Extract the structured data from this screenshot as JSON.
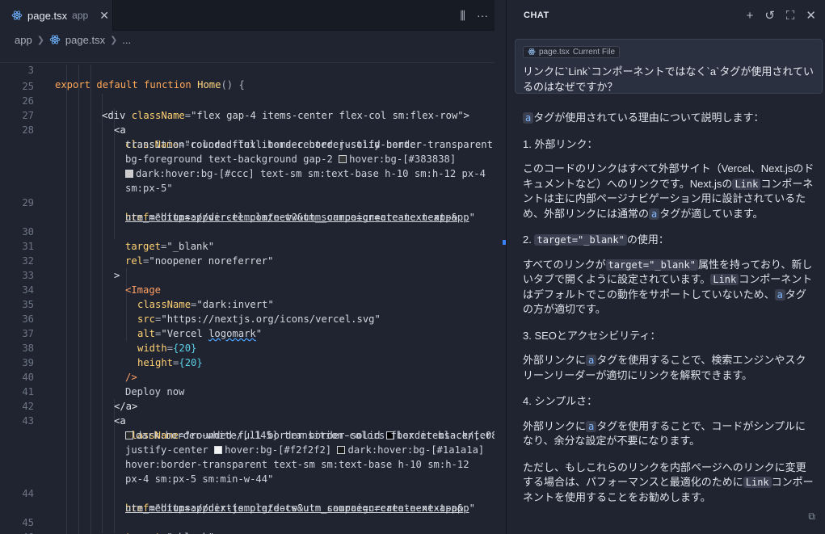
{
  "tab": {
    "file": "page.tsx",
    "dir": "app",
    "close": "✕"
  },
  "tab_actions": {
    "split": "⫼",
    "more": "···"
  },
  "breadcrumb": {
    "folder": "app",
    "file": "page.tsx",
    "more": "..."
  },
  "code": {
    "sticky": {
      "num": "3",
      "text": "export default function Home() {"
    },
    "lines": [
      {
        "num": "25"
      },
      {
        "num": "26"
      },
      {
        "num": "27"
      },
      {
        "num": "28"
      },
      {
        "num": "29"
      },
      {
        "num": "30"
      },
      {
        "num": "31"
      },
      {
        "num": "32"
      },
      {
        "num": "33"
      },
      {
        "num": "34"
      },
      {
        "num": "35"
      },
      {
        "num": "36"
      },
      {
        "num": "37"
      },
      {
        "num": "38"
      },
      {
        "num": "39"
      },
      {
        "num": "40"
      },
      {
        "num": "41"
      },
      {
        "num": "42"
      },
      {
        "num": "43"
      },
      {
        "num": "44"
      },
      {
        "num": "45"
      },
      {
        "num": "46"
      }
    ],
    "t": {
      "div_open": "<div",
      "className": "className",
      "eq": "=",
      "div_class": "\"flex gap-4 items-center flex-col sm:flex-row\"",
      "gt": ">",
      "a_open": "<a",
      "a1_class_1": "\"rounded-full border border-solid border-transparent",
      "a1_class_2": "transition-colors flex items-center justify-center",
      "a1_class_3a": "bg-foreground text-background gap-2 ",
      "a1_class_3b": "hover:bg-[#383838]",
      "a1_class_4a": "dark:hover:bg-[#ccc]",
      "a1_class_4b": " text-sm sm:text-base h-10 sm:h-12 px-4",
      "a1_class_5": "sm:px-5\"",
      "href": "href",
      "a1_href_1": "\"https://vercel.com/new?utm_source=create-next-app&",
      "a1_href_2": "utm_medium=appdir-template-tw&utm_campaign=create-next-app",
      "quote": "\"",
      "target": "target",
      "target_val": "\"_blank\"",
      "rel": "rel",
      "rel_val": "\"noopener noreferrer\"",
      "image_open": "<Image",
      "img_class_val": "\"dark:invert\"",
      "src": "src",
      "src_val": "\"https://nextjs.org/icons/vercel.svg\"",
      "alt": "alt",
      "alt_val_a": "\"Vercel ",
      "alt_val_b": "logomark",
      "width": "width",
      "height": "height",
      "num20": "{20}",
      "self_close": "/>",
      "deploy": "Deploy now",
      "a_close": "</a>",
      "a2_class_1a": "\"rounded-full border border-solid ",
      "a2_class_1b": "border-black/[.08]",
      "a2_class_2a": "dark:border-white/[.145]",
      "a2_class_2b": " transition-colors flex items-center",
      "a2_class_3a": "justify-center ",
      "a2_class_3b": "hover:bg-[#f2f2f2] ",
      "a2_class_3c": "dark:hover:bg-[#1a1a1a]",
      "a2_class_4": "hover:border-transparent text-sm sm:text-base h-10 sm:h-12",
      "a2_class_5": "px-4 sm:px-5 sm:min-w-44\"",
      "a2_href_1": "\"https://nextjs.org/docs?utm_source=create-next-app&",
      "a2_href_2": "utm_medium=appdir-template-tw&utm_campaign=create-next-app"
    }
  },
  "chat": {
    "title": "CHAT",
    "actions": {
      "new": "+",
      "history": "↺",
      "expand": "⛶",
      "close": "✕"
    },
    "context_chip": {
      "file": "page.tsx",
      "label": "Current File"
    },
    "question": "リンクに`Link`コンポーネントではなく`a`タグが使用されているのはなぜですか？",
    "answer": {
      "intro_code": "a",
      "intro": "タグが使用されている理由について説明します：",
      "h1": "1. 外部リンク：",
      "p1a": "このコードのリンクはすべて外部サイト（Vercel、Next.jsのドキュメントなど）へのリンクです。Next.jsの",
      "p1_code1": "Link",
      "p1b": "コンポーネントは主に内部ページナビゲーション用に設計されているため、外部リンクには通常の",
      "p1_code2": "a",
      "p1c": "タグが適しています。",
      "h2_num": "2. ",
      "h2_code": "target=\"_blank\"",
      "h2_text": "の使用：",
      "p2a": "すべてのリンクが",
      "p2_code1": "target=\"_blank\"",
      "p2b": "属性を持っており、新しいタブで開くように設定されています。",
      "p2_code2": "Link",
      "p2c": "コンポーネントはデフォルトでこの動作をサポートしていないため、",
      "p2_code3": "a",
      "p2d": "タグの方が適切です。",
      "h3": "3. SEOとアクセシビリティ：",
      "p3a": "外部リンクに",
      "p3_code": "a",
      "p3b": "タグを使用することで、検索エンジンやスクリーンリーダーが適切にリンクを解釈できます。",
      "h4": "4. シンプルさ：",
      "p4a": "外部リンクに",
      "p4_code": "a",
      "p4b": "タグを使用することで、コードがシンプルになり、余分な設定が不要になります。",
      "p5a": "ただし、もしこれらのリンクを内部ページへのリンクに変更する場合は、パフォーマンスと最適化のために",
      "p5_code": "Link",
      "p5b": "コンポーネントを使用することをお勧めします。"
    },
    "copy_icon": "⧉"
  }
}
